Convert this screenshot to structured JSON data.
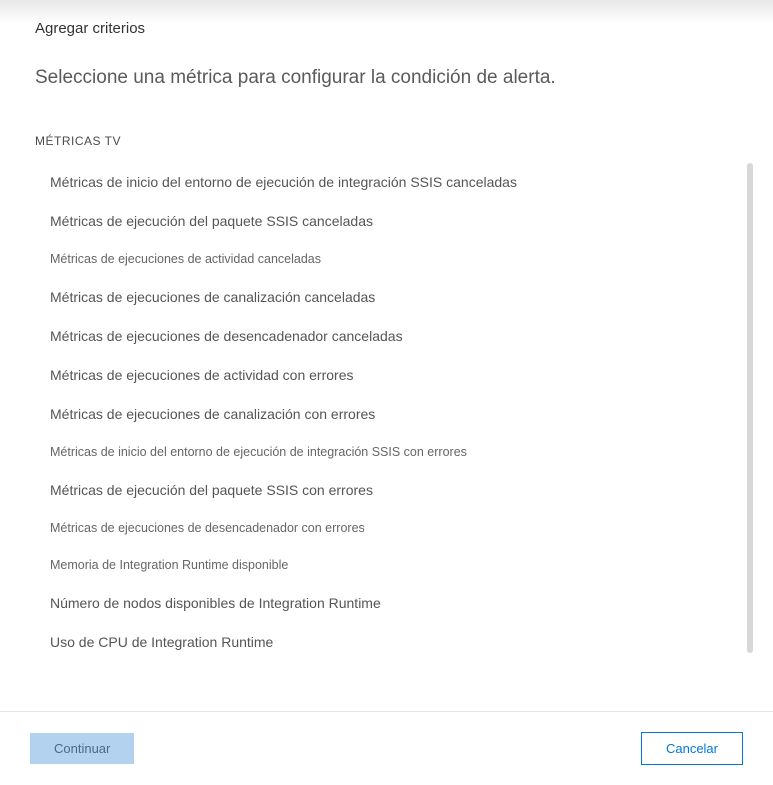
{
  "header": {
    "title": "Agregar criterios",
    "subtitle": "Seleccione una métrica para configurar la condición de alerta."
  },
  "section": {
    "label": "MÉTRICAS TV"
  },
  "metrics": [
    {
      "label": "Métricas de inicio del entorno de ejecución de integración SSIS canceladas",
      "small": false
    },
    {
      "label": "Métricas de ejecución del paquete SSIS canceladas",
      "small": false
    },
    {
      "label": "Métricas de ejecuciones de actividad canceladas",
      "small": true
    },
    {
      "label": "Métricas de ejecuciones de canalización canceladas",
      "small": false
    },
    {
      "label": "Métricas de ejecuciones de desencadenador canceladas",
      "small": false
    },
    {
      "label": "Métricas de ejecuciones de actividad con errores",
      "small": false
    },
    {
      "label": "Métricas de ejecuciones de canalización con errores",
      "small": false
    },
    {
      "label": "Métricas de inicio del entorno de ejecución de integración SSIS con errores",
      "small": true
    },
    {
      "label": "Métricas de ejecución del paquete SSIS con errores",
      "small": false
    },
    {
      "label": "Métricas de ejecuciones de desencadenador con errores",
      "small": true
    },
    {
      "label": "Memoria de Integration Runtime disponible",
      "small": true
    },
    {
      "label": "Número de nodos disponibles de Integration Runtime",
      "small": false
    },
    {
      "label": "Uso de CPU de Integration Runtime",
      "small": false
    }
  ],
  "footer": {
    "continue_label": "Continuar",
    "cancel_label": "Cancelar"
  }
}
